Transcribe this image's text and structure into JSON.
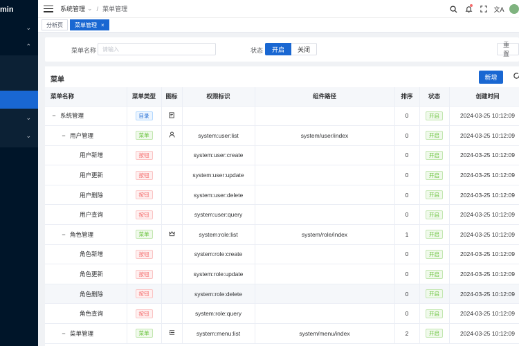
{
  "sidebar": {
    "logo": "min"
  },
  "breadcrumb": {
    "parent": "系统管理",
    "current": "菜单管理"
  },
  "tabs": [
    {
      "label": "分析页"
    },
    {
      "label": "菜单管理",
      "close": "×"
    }
  ],
  "search": {
    "name_label": "菜单名称",
    "name_placeholder": "请输入",
    "status_label": "状态",
    "status_on": "开启",
    "status_off": "关闭",
    "reset_label": "重置"
  },
  "panel": {
    "title": "菜单",
    "add_label": "新增"
  },
  "columns": [
    "菜单名称",
    "菜单类型",
    "图标",
    "权限标识",
    "组件路径",
    "排序",
    "状态",
    "创建时间"
  ],
  "rows": [
    {
      "name": "系统管理",
      "level": 0,
      "expander": "−",
      "type": "目录",
      "type_kind": "dir",
      "icon": "system-icon",
      "perm": "",
      "path": "",
      "sort": "0",
      "status": "开启",
      "created": "2024-03-25 10:12:09"
    },
    {
      "name": "用户管理",
      "level": 1,
      "expander": "−",
      "type": "菜单",
      "type_kind": "menu",
      "icon": "user-icon",
      "perm": "system:user:list",
      "path": "system/user/index",
      "sort": "0",
      "status": "开启",
      "created": "2024-03-25 10:12:09"
    },
    {
      "name": "用户新增",
      "level": 2,
      "expander": "",
      "type": "按钮",
      "type_kind": "btn",
      "icon": "",
      "perm": "system:user:create",
      "path": "",
      "sort": "0",
      "status": "开启",
      "created": "2024-03-25 10:12:09"
    },
    {
      "name": "用户更新",
      "level": 2,
      "expander": "",
      "type": "按钮",
      "type_kind": "btn",
      "icon": "",
      "perm": "system:user:update",
      "path": "",
      "sort": "0",
      "status": "开启",
      "created": "2024-03-25 10:12:09"
    },
    {
      "name": "用户删除",
      "level": 2,
      "expander": "",
      "type": "按钮",
      "type_kind": "btn",
      "icon": "",
      "perm": "system:user:delete",
      "path": "",
      "sort": "0",
      "status": "开启",
      "created": "2024-03-25 10:12:09"
    },
    {
      "name": "用户查询",
      "level": 2,
      "expander": "",
      "type": "按钮",
      "type_kind": "btn",
      "icon": "",
      "perm": "system:user:query",
      "path": "",
      "sort": "0",
      "status": "开启",
      "created": "2024-03-25 10:12:09"
    },
    {
      "name": "角色管理",
      "level": 1,
      "expander": "−",
      "type": "菜单",
      "type_kind": "menu",
      "icon": "role-icon",
      "perm": "system:role:list",
      "path": "system/role/index",
      "sort": "1",
      "status": "开启",
      "created": "2024-03-25 10:12:09"
    },
    {
      "name": "角色新增",
      "level": 2,
      "expander": "",
      "type": "按钮",
      "type_kind": "btn",
      "icon": "",
      "perm": "system:role:create",
      "path": "",
      "sort": "0",
      "status": "开启",
      "created": "2024-03-25 10:12:09"
    },
    {
      "name": "角色更新",
      "level": 2,
      "expander": "",
      "type": "按钮",
      "type_kind": "btn",
      "icon": "",
      "perm": "system:role:update",
      "path": "",
      "sort": "0",
      "status": "开启",
      "created": "2024-03-25 10:12:09"
    },
    {
      "name": "角色删除",
      "level": 2,
      "expander": "",
      "type": "按钮",
      "type_kind": "btn",
      "icon": "",
      "perm": "system:role:delete",
      "path": "",
      "sort": "0",
      "status": "开启",
      "created": "2024-03-25 10:12:09",
      "hover": true
    },
    {
      "name": "角色查询",
      "level": 2,
      "expander": "",
      "type": "按钮",
      "type_kind": "btn",
      "icon": "",
      "perm": "system:role:query",
      "path": "",
      "sort": "0",
      "status": "开启",
      "created": "2024-03-25 10:12:09"
    },
    {
      "name": "菜单管理",
      "level": 1,
      "expander": "−",
      "type": "菜单",
      "type_kind": "menu",
      "icon": "list-icon",
      "perm": "system:menu:list",
      "path": "system/menu/index",
      "sort": "2",
      "status": "开启",
      "created": "2024-03-25 10:12:09"
    }
  ]
}
